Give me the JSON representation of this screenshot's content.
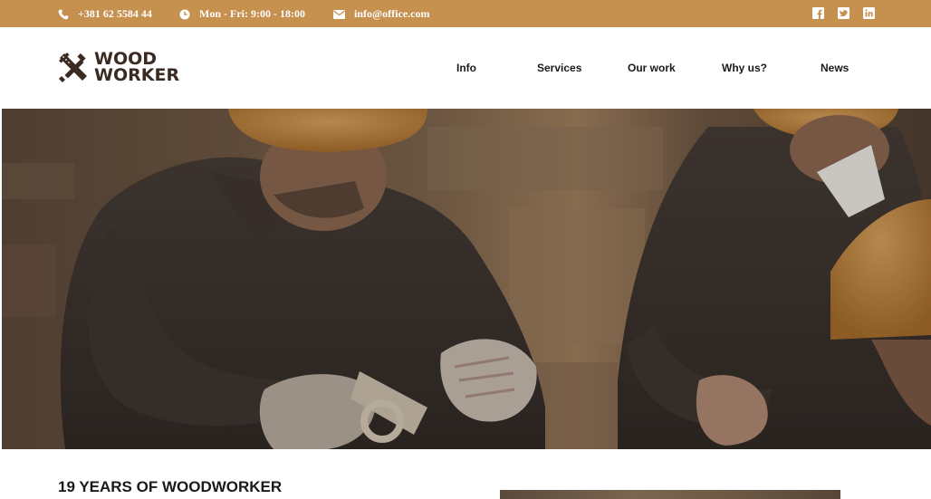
{
  "topbar": {
    "phone": "+381 62 5584 44",
    "hours": "Mon - Fri: 9:00 - 18:00",
    "email": "info@office.com",
    "background_color": "#c6904f",
    "socials": [
      "facebook-icon",
      "twitter-icon",
      "linkedin-icon"
    ]
  },
  "header": {
    "logo_line1": "WOOD",
    "logo_line2": "WORKER",
    "logo_color": "#3a2a22",
    "nav": [
      "Info",
      "Services",
      "Our work",
      "Why us?",
      "News"
    ]
  },
  "hero": {
    "image": "photo of woodworkers in orange hard hats working on wood"
  },
  "about": {
    "title": "19 YEARS OF WOODWORKER"
  }
}
